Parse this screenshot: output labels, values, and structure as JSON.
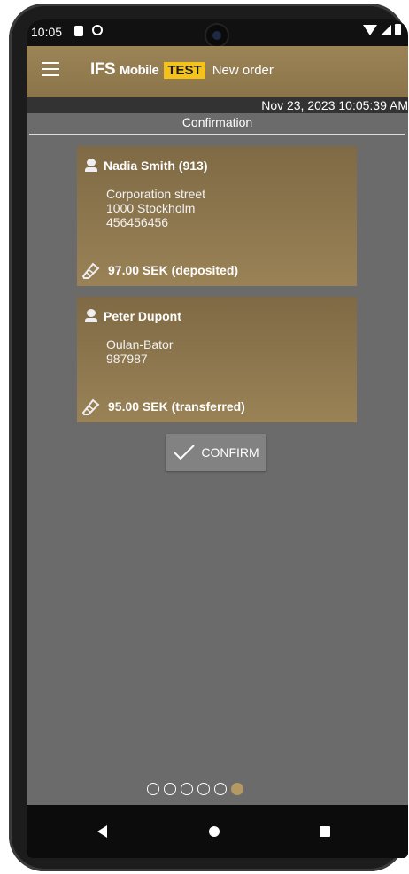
{
  "status_bar": {
    "time": "10:05"
  },
  "app_bar": {
    "brand_ifs": "IFS",
    "brand_mobile": "Mobile",
    "brand_test": "TEST",
    "title": "New order"
  },
  "date_bar": {
    "datetime": "Nov 23, 2023 10:05:39 AM"
  },
  "section": {
    "title": "Confirmation"
  },
  "cards": [
    {
      "name": "Nadia Smith (913)",
      "address_lines": [
        "Corporation street",
        "1000 Stockholm",
        "456456456"
      ],
      "amount": "97.00 SEK (deposited)"
    },
    {
      "name": "Peter Dupont",
      "address_lines": [
        "Oulan-Bator",
        "987987"
      ],
      "amount": "95.00 SEK (transferred)"
    }
  ],
  "confirm_button": {
    "label": "CONFIRM"
  },
  "pager": {
    "total": 6,
    "active_index": 5
  },
  "colors": {
    "accent": "#9c8457",
    "test_badge": "#f3c21b",
    "background": "#6b6b6b"
  },
  "icons": [
    "menu-icon",
    "person-icon",
    "tag-icon",
    "check-icon",
    "back-icon",
    "home-icon",
    "recents-icon"
  ]
}
